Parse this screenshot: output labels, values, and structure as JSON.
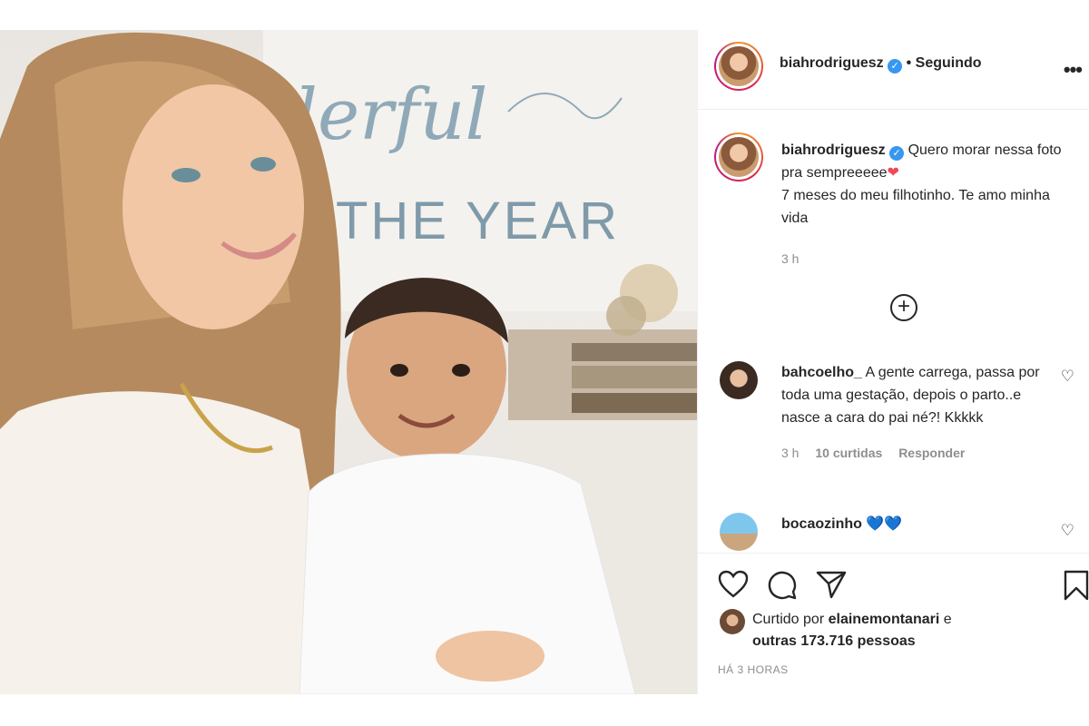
{
  "photo": {
    "sign_word_1": "lerful",
    "sign_word_2": "THE YEAR"
  },
  "header": {
    "username": "biahrodriguesz",
    "verified_mark": "✓",
    "separator": "•",
    "follow_status": "Seguindo",
    "more_icon": "•••"
  },
  "caption": {
    "username": "biahrodriguesz",
    "text_line1": " Quero morar nessa foto pra sempreeeee",
    "heart": "❤",
    "text_line2": "7 meses do meu filhotinho. Te amo minha vida",
    "time": "3 h"
  },
  "load_more": {
    "icon": "+"
  },
  "comments": [
    {
      "username": "bahcoelho_",
      "text": "A gente carrega, passa por toda uma gestação, depois o parto..e nasce a cara do pai né?! Kkkkk",
      "time": "3 h",
      "likes": "10 curtidas",
      "reply": "Responder"
    },
    {
      "username": "bocaozinho",
      "text": "💙💙"
    }
  ],
  "likes": {
    "prefix": "Curtido por ",
    "user": "elainemontanari",
    "middle": " e",
    "others": "outras 173.716 pessoas"
  },
  "posted": "HÁ 3 HORAS",
  "colors": {
    "verified": "#3897f0",
    "muted": "#8e8e8e",
    "text": "#262626",
    "heart_red": "#ed4956",
    "blue_heart": "#1d6fd6"
  },
  "icons": [
    "heart-icon",
    "comment-icon",
    "share-icon",
    "bookmark-icon",
    "more-icon",
    "plus-circle-icon",
    "verified-icon"
  ]
}
